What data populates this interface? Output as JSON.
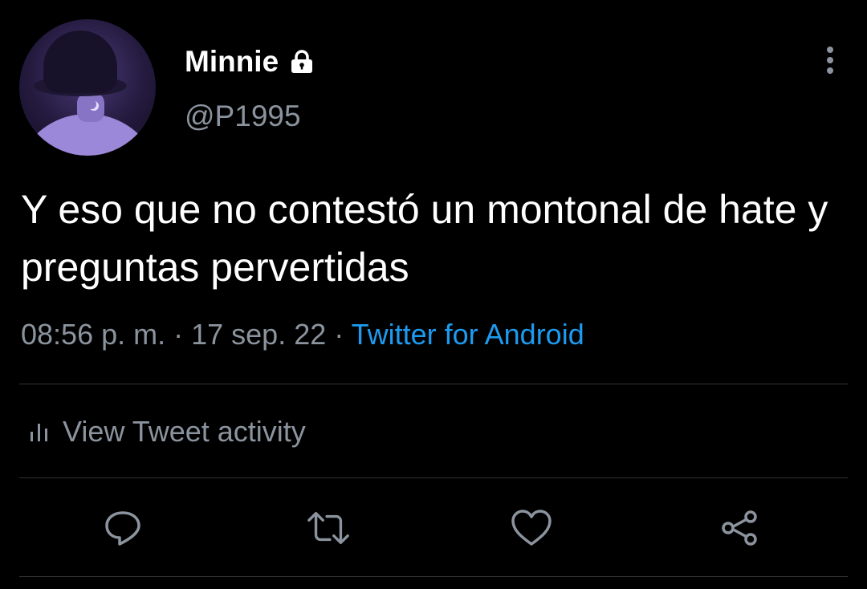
{
  "user": {
    "name": "Minnie",
    "handle": "@P1995",
    "protected_icon": "lock-icon"
  },
  "tweet": {
    "text": "Y eso que no contestó un montonal de hate y preguntas pervertidas",
    "time": "08:56 p. m.",
    "separator1": " · ",
    "date": "17 sep. 22",
    "separator2": " · ",
    "source": "Twitter for Android"
  },
  "activity": {
    "label": "View Tweet activity",
    "icon": "bar-chart-icon"
  },
  "actions": {
    "reply_icon": "reply-icon",
    "retweet_icon": "retweet-icon",
    "like_icon": "heart-icon",
    "share_icon": "share-icon"
  },
  "colors": {
    "background": "#000000",
    "primary_text": "#ffffff",
    "secondary_text": "#8b949e",
    "link": "#1d9bf0",
    "divider": "#2f3336"
  }
}
